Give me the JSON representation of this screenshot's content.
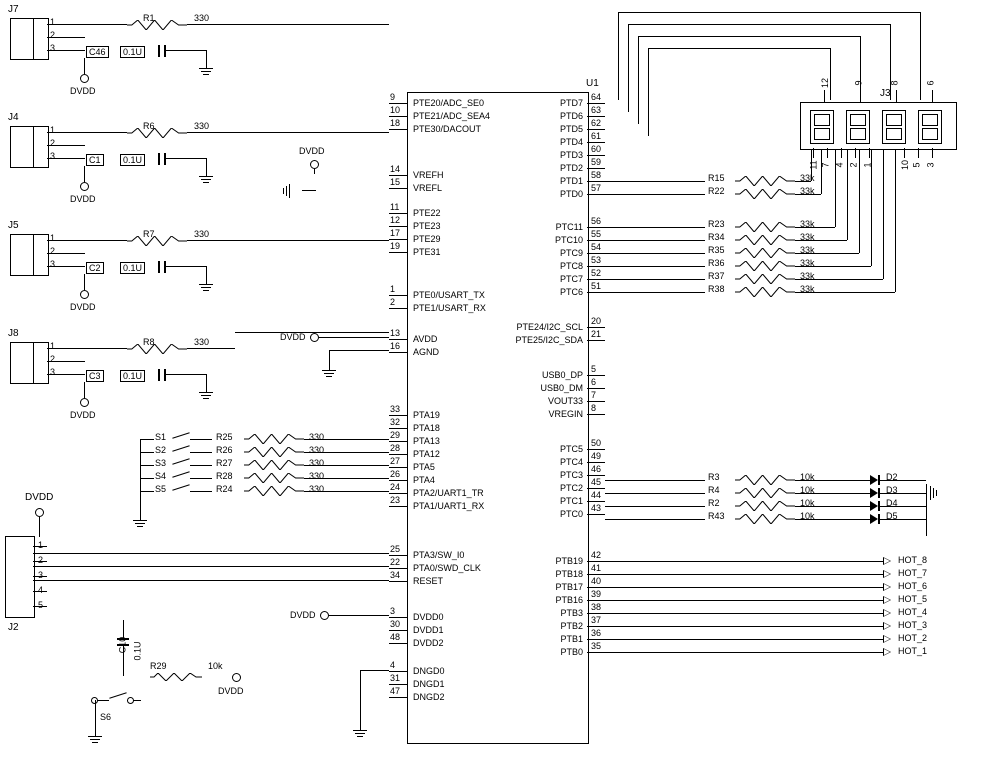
{
  "chip": {
    "ref": "U1",
    "left_pins": [
      {
        "num": "9",
        "name": "PTE20/ADC_SE0"
      },
      {
        "num": "10",
        "name": "PTE21/ADC_SEA4"
      },
      {
        "num": "18",
        "name": "PTE30/DACOUT"
      },
      {
        "num": "14",
        "name": "VREFH"
      },
      {
        "num": "15",
        "name": "VREFL"
      },
      {
        "num": "11",
        "name": "PTE22"
      },
      {
        "num": "12",
        "name": "PTE23"
      },
      {
        "num": "17",
        "name": "PTE29"
      },
      {
        "num": "19",
        "name": "PTE31"
      },
      {
        "num": "1",
        "name": "PTE0/USART_TX"
      },
      {
        "num": "2",
        "name": "PTE1/USART_RX"
      },
      {
        "num": "13",
        "name": "AVDD"
      },
      {
        "num": "16",
        "name": "AGND"
      },
      {
        "num": "33",
        "name": "PTA19"
      },
      {
        "num": "32",
        "name": "PTA18"
      },
      {
        "num": "29",
        "name": "PTA13"
      },
      {
        "num": "28",
        "name": "PTA12"
      },
      {
        "num": "27",
        "name": "PTA5"
      },
      {
        "num": "26",
        "name": "PTA4"
      },
      {
        "num": "24",
        "name": "PTA2/UART1_TR"
      },
      {
        "num": "23",
        "name": "PTA1/UART1_RX"
      },
      {
        "num": "25",
        "name": "PTA3/SW_I0"
      },
      {
        "num": "22",
        "name": "PTA0/SWD_CLK"
      },
      {
        "num": "34",
        "name": "RESET"
      },
      {
        "num": "3",
        "name": "DVDD0"
      },
      {
        "num": "30",
        "name": "DVDD1"
      },
      {
        "num": "48",
        "name": "DVDD2"
      },
      {
        "num": "4",
        "name": "DNGD0"
      },
      {
        "num": "31",
        "name": "DNGD1"
      },
      {
        "num": "47",
        "name": "DNGD2"
      }
    ],
    "right_pins": [
      {
        "num": "64",
        "name": "PTD7"
      },
      {
        "num": "63",
        "name": "PTD6"
      },
      {
        "num": "62",
        "name": "PTD5"
      },
      {
        "num": "61",
        "name": "PTD4"
      },
      {
        "num": "60",
        "name": "PTD3"
      },
      {
        "num": "59",
        "name": "PTD2"
      },
      {
        "num": "58",
        "name": "PTD1"
      },
      {
        "num": "57",
        "name": "PTD0"
      },
      {
        "num": "56",
        "name": "PTC11"
      },
      {
        "num": "55",
        "name": "PTC10"
      },
      {
        "num": "54",
        "name": "PTC9"
      },
      {
        "num": "53",
        "name": "PTC8"
      },
      {
        "num": "52",
        "name": "PTC7"
      },
      {
        "num": "51",
        "name": "PTC6"
      },
      {
        "num": "20",
        "name": "PTE24/I2C_SCL"
      },
      {
        "num": "21",
        "name": "PTE25/I2C_SDA"
      },
      {
        "num": "5",
        "name": "USB0_DP"
      },
      {
        "num": "6",
        "name": "USB0_DM"
      },
      {
        "num": "7",
        "name": "VOUT33"
      },
      {
        "num": "8",
        "name": "VREGIN"
      },
      {
        "num": "50",
        "name": "PTC5"
      },
      {
        "num": "49",
        "name": "PTC4"
      },
      {
        "num": "46",
        "name": "PTC3"
      },
      {
        "num": "45",
        "name": "PTC2"
      },
      {
        "num": "44",
        "name": "PTC1"
      },
      {
        "num": "43",
        "name": "PTC0"
      },
      {
        "num": "42",
        "name": "PTB19"
      },
      {
        "num": "41",
        "name": "PTB18"
      },
      {
        "num": "40",
        "name": "PTB17"
      },
      {
        "num": "39",
        "name": "PTB16"
      },
      {
        "num": "38",
        "name": "PTB3"
      },
      {
        "num": "37",
        "name": "PTB2"
      },
      {
        "num": "36",
        "name": "PTB1"
      },
      {
        "num": "35",
        "name": "PTB0"
      }
    ]
  },
  "analog_inputs": [
    {
      "conn": "J7",
      "r": "R1",
      "rv": "330",
      "c": "C46",
      "cv": "0.1U"
    },
    {
      "conn": "J4",
      "r": "R6",
      "rv": "330",
      "c": "C1",
      "cv": "0.1U"
    },
    {
      "conn": "J5",
      "r": "R7",
      "rv": "330",
      "c": "C2",
      "cv": "0.1U"
    },
    {
      "conn": "J8",
      "r": "R8",
      "rv": "330",
      "c": "C3",
      "cv": "0.1U"
    }
  ],
  "switches_res": [
    {
      "s": "S1",
      "r": "R25",
      "v": "330"
    },
    {
      "s": "S2",
      "r": "R26",
      "v": "330"
    },
    {
      "s": "S3",
      "r": "R27",
      "v": "330"
    },
    {
      "s": "S4",
      "r": "R28",
      "v": "330"
    },
    {
      "s": "S5",
      "r": "R24",
      "v": "330"
    }
  ],
  "display_res": [
    {
      "r": "R15",
      "v": "33k"
    },
    {
      "r": "R22",
      "v": "33k"
    },
    {
      "r": "R23",
      "v": "33k"
    },
    {
      "r": "R34",
      "v": "33k"
    },
    {
      "r": "R35",
      "v": "33k"
    },
    {
      "r": "R36",
      "v": "33k"
    },
    {
      "r": "R37",
      "v": "33k"
    },
    {
      "r": "R38",
      "v": "33k"
    }
  ],
  "led_res": [
    {
      "r": "R3",
      "v": "10k",
      "d": "D2"
    },
    {
      "r": "R4",
      "v": "10k",
      "d": "D3"
    },
    {
      "r": "R2",
      "v": "10k",
      "d": "D4"
    },
    {
      "r": "R43",
      "v": "10k",
      "d": "D5"
    }
  ],
  "hot": [
    "HOT_8",
    "HOT_7",
    "HOT_6",
    "HOT_5",
    "HOT_4",
    "HOT_3",
    "HOT_2",
    "HOT_1"
  ],
  "misc": {
    "dv": "DVDD",
    "j2": "J2",
    "j3": "J3",
    "c10": "C10",
    "c10v": "0.1U",
    "r29": "R29",
    "r29v": "10k",
    "s6": "S6",
    "j3_pins_top": [
      "12",
      "9",
      "8",
      "6"
    ],
    "j3_pins_bot": [
      "11",
      "7",
      "4",
      "2",
      "1",
      "10",
      "5",
      "3"
    ],
    "conn_pins": [
      "1",
      "2",
      "3"
    ],
    "j2_pins": [
      "1",
      "2",
      "3",
      "4",
      "5"
    ]
  }
}
